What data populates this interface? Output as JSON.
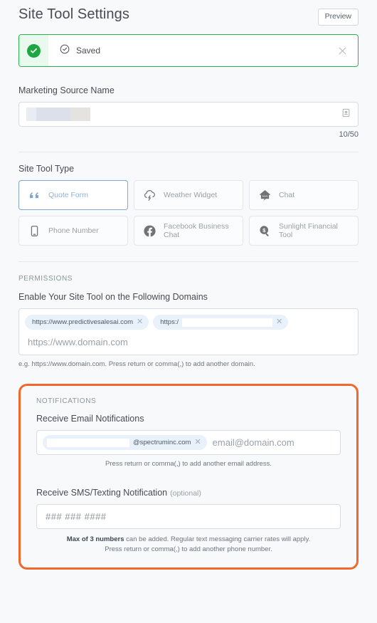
{
  "header": {
    "title": "Site Tool Settings",
    "preview_label": "Preview"
  },
  "alert": {
    "text": "Saved",
    "status_color": "#1da642",
    "border_color": "#2bb24c",
    "badge_bg": "#e9f9ed"
  },
  "marketing_source": {
    "label": "Marketing Source Name",
    "value": "",
    "value_redacted": true,
    "char_count": "10/50"
  },
  "site_tool_type": {
    "label": "Site Tool Type",
    "selected": "Quote Form",
    "accent_color": "#7da6d1",
    "options": [
      {
        "label": "Quote Form",
        "icon": "quote-icon",
        "selected": true
      },
      {
        "label": "Weather Widget",
        "icon": "cloud-lightning-icon",
        "selected": false
      },
      {
        "label": "Chat",
        "icon": "home-chat-icon",
        "selected": false
      },
      {
        "label": "Phone Number",
        "icon": "mobile-phone-icon",
        "selected": false
      },
      {
        "label": "Facebook Business Chat",
        "icon": "facebook-icon",
        "selected": false
      },
      {
        "label": "Sunlight Financial Tool",
        "icon": "magnifier-dollar-icon",
        "selected": false
      }
    ]
  },
  "permissions": {
    "section_title": "PERMISSIONS",
    "domains_label": "Enable Your Site Tool on the Following Domains",
    "domain_chips": [
      {
        "text": "https://www.predictivesalesai.com",
        "redacted": false
      },
      {
        "text": "https:/",
        "redacted": true
      }
    ],
    "domains_placeholder": "https://www.domain.com",
    "domains_helper": "e.g. https://www.domain.com. Press return or comma(,) to add another domain."
  },
  "notifications": {
    "section_title": "NOTIFICATIONS",
    "highlight_color": "#f2682a",
    "email_label": "Receive Email Notifications",
    "email_chips": [
      {
        "text": "@spectruminc.com",
        "redacted": true
      }
    ],
    "email_placeholder": "email@domain.com",
    "email_helper": "Press return or comma(,) to add another email address.",
    "sms_label": "Receive SMS/Texting Notification",
    "sms_optional": "(optional)",
    "sms_placeholder": "### ### ####",
    "sms_helper_bold": "Max of 3 numbers",
    "sms_helper_rest": " can be added. Regular text messaging carrier rates will apply.",
    "sms_helper_line2": "Press return or comma(,) to add another phone number."
  }
}
